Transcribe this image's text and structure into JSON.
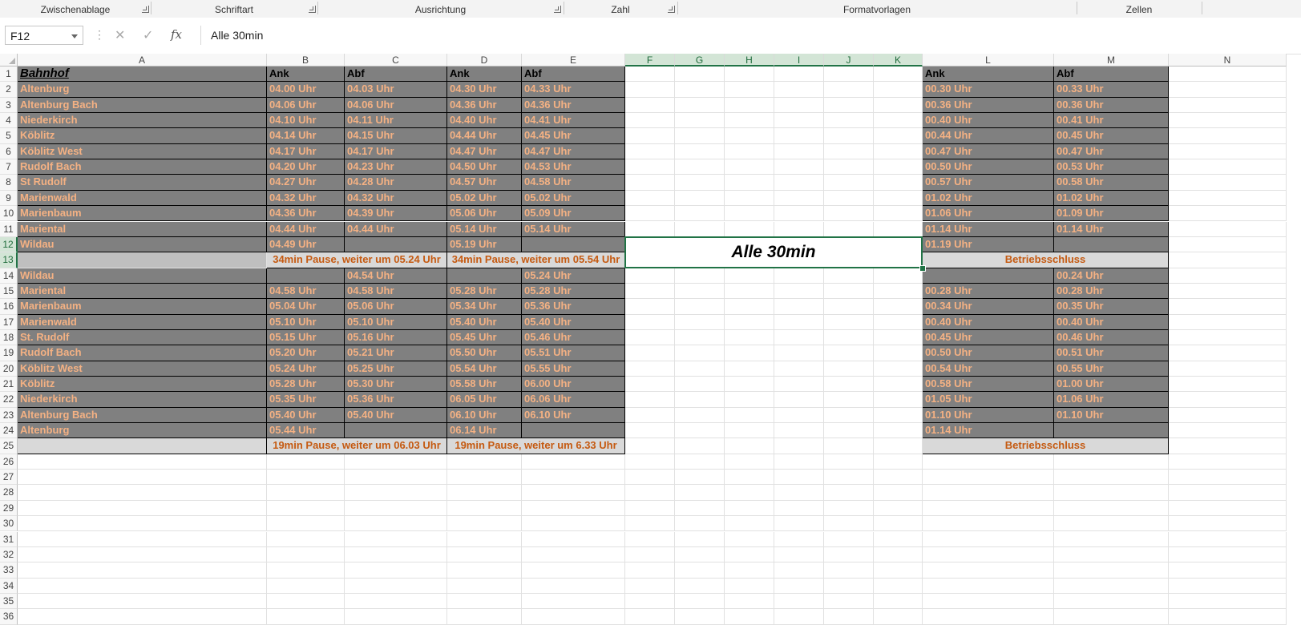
{
  "ribbon": {
    "groups": [
      "Zwischenablage",
      "Schriftart",
      "Ausrichtung",
      "Zahl",
      "Formatvorlagen",
      "Zellen"
    ]
  },
  "formula_bar": {
    "name_box": "F12",
    "content": "Alle 30min"
  },
  "columns": [
    "A",
    "B",
    "C",
    "D",
    "E",
    "F",
    "G",
    "H",
    "I",
    "J",
    "K",
    "L",
    "M",
    "N"
  ],
  "rows": [
    "1",
    "2",
    "3",
    "4",
    "5",
    "6",
    "7",
    "8",
    "9",
    "10",
    "11",
    "12",
    "13",
    "14",
    "15",
    "16",
    "17",
    "18",
    "19",
    "20",
    "21",
    "22",
    "23",
    "24",
    "25",
    "26",
    "27",
    "28",
    "29",
    "30",
    "31",
    "32",
    "33",
    "34",
    "35",
    "36"
  ],
  "sheet": {
    "header": {
      "station": "Bahnhof",
      "ank": "Ank",
      "abf": "Abf"
    },
    "rows": [
      [
        "Altenburg",
        "04.00 Uhr",
        "04.03 Uhr",
        "04.30 Uhr",
        "04.33 Uhr",
        "00.30 Uhr",
        "00.33 Uhr"
      ],
      [
        "Altenburg Bach",
        "04.06 Uhr",
        "04.06 Uhr",
        "04.36 Uhr",
        "04.36 Uhr",
        "00.36 Uhr",
        "00.36 Uhr"
      ],
      [
        "Niederkirch",
        "04.10 Uhr",
        "04.11 Uhr",
        "04.40 Uhr",
        "04.41 Uhr",
        "00.40 Uhr",
        "00.41 Uhr"
      ],
      [
        "Köblitz",
        "04.14 Uhr",
        "04.15 Uhr",
        "04.44 Uhr",
        "04.45 Uhr",
        "00.44 Uhr",
        "00.45 Uhr"
      ],
      [
        "Köblitz West",
        "04.17 Uhr",
        "04.17 Uhr",
        "04.47 Uhr",
        "04.47 Uhr",
        "00.47 Uhr",
        "00.47 Uhr"
      ],
      [
        "Rudolf Bach",
        "04.20 Uhr",
        "04.23 Uhr",
        "04.50 Uhr",
        "04.53 Uhr",
        "00.50 Uhr",
        "00.53 Uhr"
      ],
      [
        "St Rudolf",
        "04.27 Uhr",
        "04.28 Uhr",
        "04.57 Uhr",
        "04.58 Uhr",
        "00.57 Uhr",
        "00.58 Uhr"
      ],
      [
        "Marienwald",
        "04.32 Uhr",
        "04.32 Uhr",
        "05.02 Uhr",
        "05.02 Uhr",
        "01.02 Uhr",
        "01.02 Uhr"
      ],
      [
        "Marienbaum",
        "04.36 Uhr",
        "04.39 Uhr",
        "05.06 Uhr",
        "05.09 Uhr",
        "01.06 Uhr",
        "01.09 Uhr"
      ],
      [
        "Mariental",
        "04.44 Uhr",
        "04.44 Uhr",
        "05.14 Uhr",
        "05.14 Uhr",
        "01.14 Uhr",
        "01.14 Uhr"
      ],
      [
        "Wildau",
        "04.49 Uhr",
        "",
        "05.19 Uhr",
        "",
        "01.19 Uhr",
        ""
      ],
      [
        "",
        "",
        "",
        "",
        "",
        "",
        ""
      ],
      [
        "Wildau",
        "",
        "04.54 Uhr",
        "",
        "05.24 Uhr",
        "",
        "00.24 Uhr"
      ],
      [
        "Mariental",
        "04.58 Uhr",
        "04.58 Uhr",
        "05.28 Uhr",
        "05.28 Uhr",
        "00.28 Uhr",
        "00.28 Uhr"
      ],
      [
        "Marienbaum",
        "05.04 Uhr",
        "05.06 Uhr",
        "05.34 Uhr",
        "05.36 Uhr",
        "00.34 Uhr",
        "00.35 Uhr"
      ],
      [
        "Marienwald",
        "05.10 Uhr",
        "05.10 Uhr",
        "05.40 Uhr",
        "05.40 Uhr",
        "00.40 Uhr",
        "00.40 Uhr"
      ],
      [
        "St. Rudolf",
        "05.15 Uhr",
        "05.16 Uhr",
        "05.45 Uhr",
        "05.46 Uhr",
        "00.45 Uhr",
        "00.46 Uhr"
      ],
      [
        "Rudolf Bach",
        "05.20 Uhr",
        "05.21 Uhr",
        "05.50 Uhr",
        "05.51 Uhr",
        "00.50 Uhr",
        "00.51 Uhr"
      ],
      [
        "Köblitz West",
        "05.24 Uhr",
        "05.25 Uhr",
        "05.54 Uhr",
        "05.55 Uhr",
        "00.54 Uhr",
        "00.55 Uhr"
      ],
      [
        "Köblitz",
        "05.28 Uhr",
        "05.30 Uhr",
        "05.58 Uhr",
        "06.00 Uhr",
        "00.58 Uhr",
        "01.00 Uhr"
      ],
      [
        "Niederkirch",
        "05.35 Uhr",
        "05.36 Uhr",
        "06.05 Uhr",
        "06.06 Uhr",
        "01.05 Uhr",
        "01.06 Uhr"
      ],
      [
        "Altenburg Bach",
        "05.40 Uhr",
        "05.40 Uhr",
        "06.10 Uhr",
        "06.10 Uhr",
        "01.10 Uhr",
        "01.10 Uhr"
      ],
      [
        "Altenburg",
        "05.44 Uhr",
        "",
        "06.14 Uhr",
        "",
        "01.14 Uhr",
        ""
      ]
    ],
    "notes": {
      "row13_bc": "34min Pause, weiter um 05.24 Uhr",
      "row13_de": "34min Pause, weiter um 05.54 Uhr",
      "row13_lm": "Betriebsschluss",
      "row25_bc": "19min Pause, weiter um 06.03 Uhr",
      "row25_de": "19min Pause, weiter um 6.33 Uhr",
      "row25_lm": "Betriebsschluss"
    },
    "merged_text": "Alle 30min"
  }
}
